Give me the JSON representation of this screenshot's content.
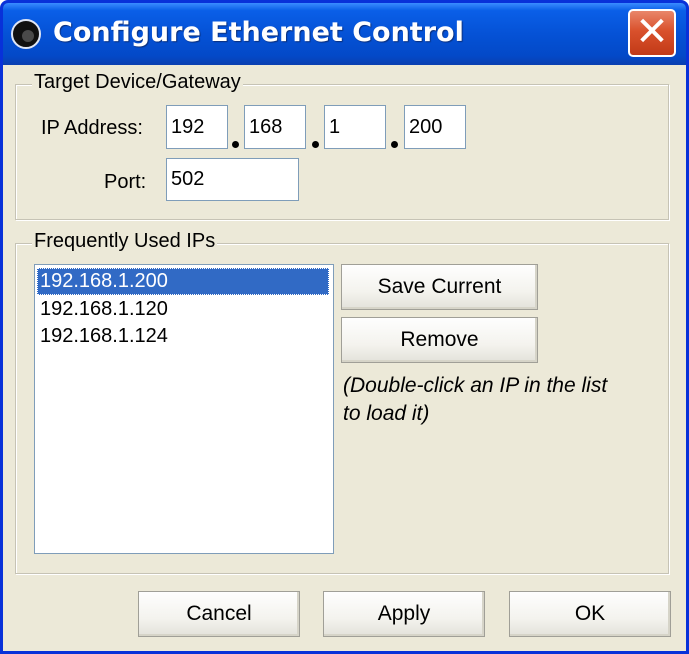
{
  "window": {
    "title": "Configure Ethernet Control",
    "close_glyph": "✕"
  },
  "target_group": {
    "legend": "Target Device/Gateway",
    "ip_label": "IP Address:",
    "ip_octets": [
      "192",
      "168",
      "1",
      "200"
    ],
    "port_label": "Port:",
    "port_value": "502"
  },
  "frequent_group": {
    "legend": "Frequently Used IPs",
    "items": [
      {
        "label": "192.168.1.200",
        "selected": true
      },
      {
        "label": "192.168.1.120",
        "selected": false
      },
      {
        "label": "192.168.1.124",
        "selected": false
      }
    ],
    "save_label": "Save Current",
    "remove_label": "Remove",
    "hint_line1": "(Double-click an IP in the list",
    "hint_line2": "to load it)"
  },
  "footer": {
    "cancel_label": "Cancel",
    "apply_label": "Apply",
    "ok_label": "OK"
  },
  "colors": {
    "title_bar": "#0552d6",
    "selection": "#316ac5",
    "close_button": "#d9512c",
    "dialog_face": "#ece9d8"
  }
}
